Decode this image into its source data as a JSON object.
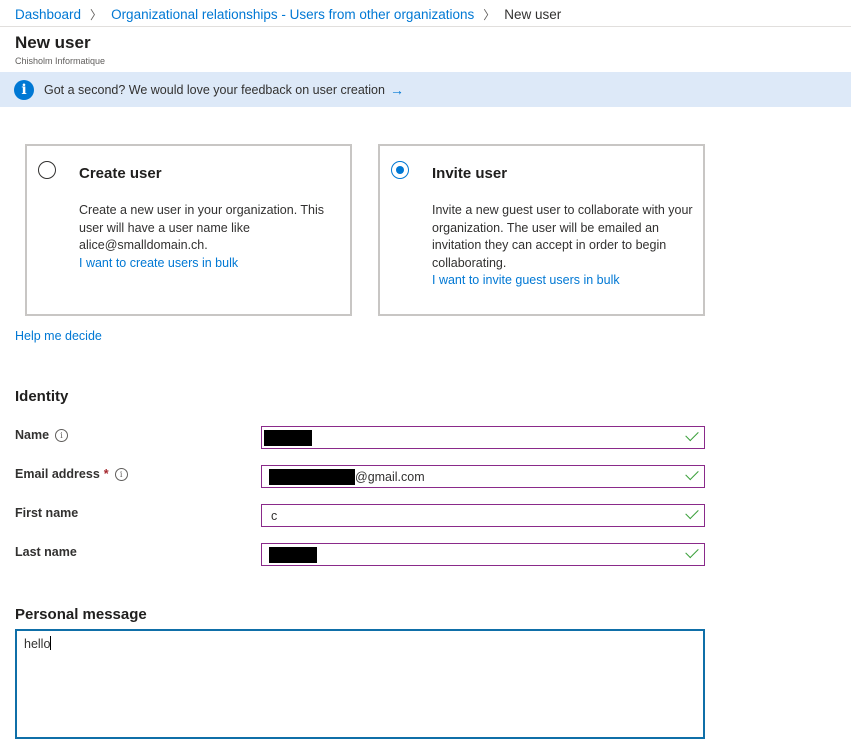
{
  "breadcrumb": {
    "items": [
      "Dashboard",
      "Organizational relationships - Users from other organizations"
    ],
    "current": "New user"
  },
  "header": {
    "title": "New user",
    "subtitle": "Chisholm Informatique"
  },
  "banner": {
    "text": "Got a second? We would love your feedback on user creation",
    "arrow": "→",
    "info_glyph": "i"
  },
  "options": {
    "create": {
      "title": "Create user",
      "description": "Create a new user in your organization. This user will have a user name like alice@smalldomain.ch.",
      "link": "I want to create users in bulk",
      "selected": false
    },
    "invite": {
      "title": "Invite user",
      "description": "Invite a new guest user to collaborate with your organization. The user will be emailed an invitation they can accept in order to begin collaborating.",
      "link": "I want to invite guest users in bulk",
      "selected": true
    }
  },
  "help_link": "Help me decide",
  "identity": {
    "title": "Identity",
    "fields": {
      "name": {
        "label": "Name",
        "value": "",
        "redacted": true,
        "valid": true
      },
      "email": {
        "label": "Email address",
        "required_mark": "*",
        "value": "@gmail.com",
        "redacted": true,
        "valid": true
      },
      "first_name": {
        "label": "First name",
        "value": "c",
        "valid": true
      },
      "last_name": {
        "label": "Last name",
        "value": "",
        "redacted": true,
        "valid": true
      }
    }
  },
  "personal_message": {
    "title": "Personal message",
    "value": "hello"
  },
  "icons": {
    "info_small": "i"
  },
  "colors": {
    "accent": "#0078d4",
    "banner_bg": "#dde9f8",
    "valid_check": "#3aa03a",
    "field_border": "#8a2a8a",
    "required": "#a4262c"
  }
}
